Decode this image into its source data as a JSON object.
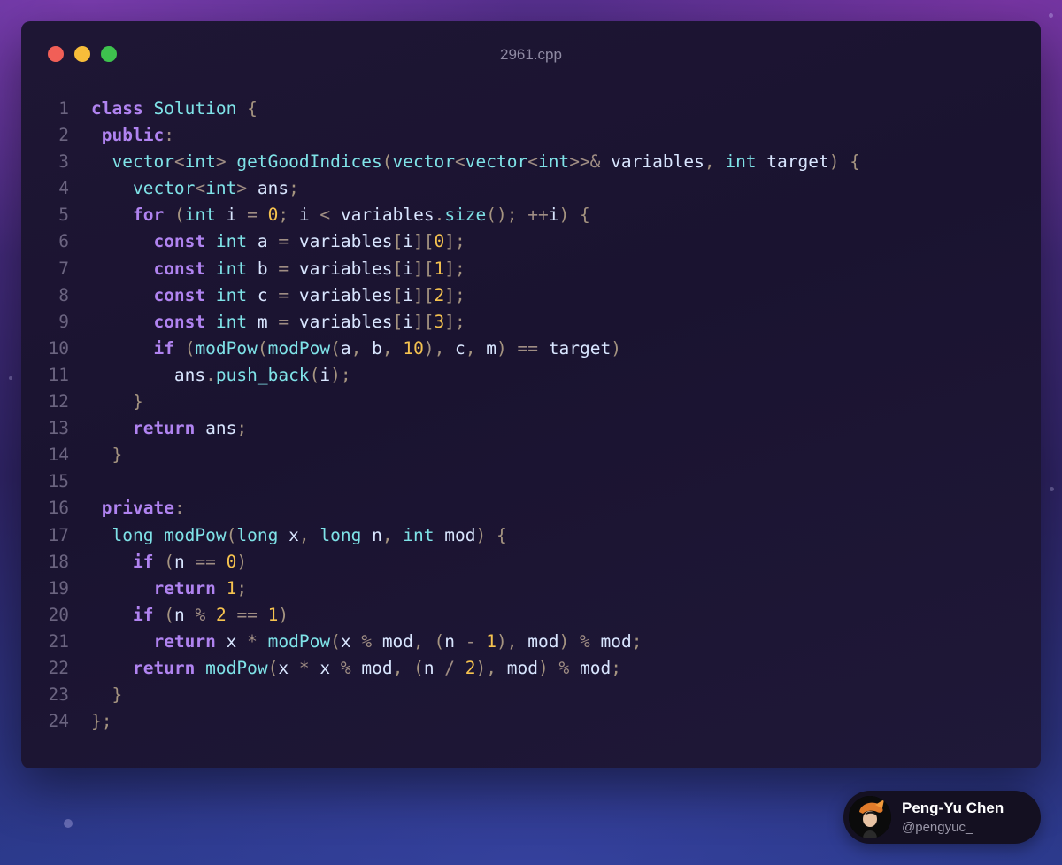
{
  "window": {
    "filename": "2961.cpp"
  },
  "code_lines": [
    [
      [
        "kw",
        "class"
      ],
      [
        "id",
        " "
      ],
      [
        "ty",
        "Solution"
      ],
      [
        "id",
        " "
      ],
      [
        "pn",
        "{"
      ]
    ],
    [
      [
        "id",
        " "
      ],
      [
        "kw",
        "public"
      ],
      [
        "op",
        ":"
      ]
    ],
    [
      [
        "id",
        "  "
      ],
      [
        "ty",
        "vector"
      ],
      [
        "op",
        "<"
      ],
      [
        "ty",
        "int"
      ],
      [
        "op",
        ">"
      ],
      [
        "id",
        " "
      ],
      [
        "fn",
        "getGoodIndices"
      ],
      [
        "pn",
        "("
      ],
      [
        "ty",
        "vector"
      ],
      [
        "op",
        "<"
      ],
      [
        "ty",
        "vector"
      ],
      [
        "op",
        "<"
      ],
      [
        "ty",
        "int"
      ],
      [
        "op",
        ">>&"
      ],
      [
        "id",
        " variables"
      ],
      [
        "pn",
        ","
      ],
      [
        "id",
        " "
      ],
      [
        "ty",
        "int"
      ],
      [
        "id",
        " target"
      ],
      [
        "pn",
        ")"
      ],
      [
        "id",
        " "
      ],
      [
        "pn",
        "{"
      ]
    ],
    [
      [
        "id",
        "    "
      ],
      [
        "ty",
        "vector"
      ],
      [
        "op",
        "<"
      ],
      [
        "ty",
        "int"
      ],
      [
        "op",
        ">"
      ],
      [
        "id",
        " ans"
      ],
      [
        "pn",
        ";"
      ]
    ],
    [
      [
        "id",
        "    "
      ],
      [
        "kw",
        "for"
      ],
      [
        "id",
        " "
      ],
      [
        "pn",
        "("
      ],
      [
        "ty",
        "int"
      ],
      [
        "id",
        " i "
      ],
      [
        "op",
        "="
      ],
      [
        "id",
        " "
      ],
      [
        "num",
        "0"
      ],
      [
        "pn",
        ";"
      ],
      [
        "id",
        " i "
      ],
      [
        "op",
        "<"
      ],
      [
        "id",
        " variables"
      ],
      [
        "op",
        "."
      ],
      [
        "fn",
        "size"
      ],
      [
        "pn",
        "()"
      ],
      [
        "pn",
        ";"
      ],
      [
        "id",
        " "
      ],
      [
        "op",
        "++"
      ],
      [
        "id",
        "i"
      ],
      [
        "pn",
        ")"
      ],
      [
        "id",
        " "
      ],
      [
        "pn",
        "{"
      ]
    ],
    [
      [
        "id",
        "      "
      ],
      [
        "kw",
        "const"
      ],
      [
        "id",
        " "
      ],
      [
        "ty",
        "int"
      ],
      [
        "id",
        " a "
      ],
      [
        "op",
        "="
      ],
      [
        "id",
        " variables"
      ],
      [
        "pn",
        "["
      ],
      [
        "id",
        "i"
      ],
      [
        "pn",
        "]["
      ],
      [
        "num",
        "0"
      ],
      [
        "pn",
        "]"
      ],
      [
        "pn",
        ";"
      ]
    ],
    [
      [
        "id",
        "      "
      ],
      [
        "kw",
        "const"
      ],
      [
        "id",
        " "
      ],
      [
        "ty",
        "int"
      ],
      [
        "id",
        " b "
      ],
      [
        "op",
        "="
      ],
      [
        "id",
        " variables"
      ],
      [
        "pn",
        "["
      ],
      [
        "id",
        "i"
      ],
      [
        "pn",
        "]["
      ],
      [
        "num",
        "1"
      ],
      [
        "pn",
        "]"
      ],
      [
        "pn",
        ";"
      ]
    ],
    [
      [
        "id",
        "      "
      ],
      [
        "kw",
        "const"
      ],
      [
        "id",
        " "
      ],
      [
        "ty",
        "int"
      ],
      [
        "id",
        " c "
      ],
      [
        "op",
        "="
      ],
      [
        "id",
        " variables"
      ],
      [
        "pn",
        "["
      ],
      [
        "id",
        "i"
      ],
      [
        "pn",
        "]["
      ],
      [
        "num",
        "2"
      ],
      [
        "pn",
        "]"
      ],
      [
        "pn",
        ";"
      ]
    ],
    [
      [
        "id",
        "      "
      ],
      [
        "kw",
        "const"
      ],
      [
        "id",
        " "
      ],
      [
        "ty",
        "int"
      ],
      [
        "id",
        " m "
      ],
      [
        "op",
        "="
      ],
      [
        "id",
        " variables"
      ],
      [
        "pn",
        "["
      ],
      [
        "id",
        "i"
      ],
      [
        "pn",
        "]["
      ],
      [
        "num",
        "3"
      ],
      [
        "pn",
        "]"
      ],
      [
        "pn",
        ";"
      ]
    ],
    [
      [
        "id",
        "      "
      ],
      [
        "kw",
        "if"
      ],
      [
        "id",
        " "
      ],
      [
        "pn",
        "("
      ],
      [
        "fn",
        "modPow"
      ],
      [
        "pn",
        "("
      ],
      [
        "fn",
        "modPow"
      ],
      [
        "pn",
        "("
      ],
      [
        "id",
        "a"
      ],
      [
        "pn",
        ","
      ],
      [
        "id",
        " b"
      ],
      [
        "pn",
        ","
      ],
      [
        "id",
        " "
      ],
      [
        "num",
        "10"
      ],
      [
        "pn",
        ")"
      ],
      [
        "pn",
        ","
      ],
      [
        "id",
        " c"
      ],
      [
        "pn",
        ","
      ],
      [
        "id",
        " m"
      ],
      [
        "pn",
        ")"
      ],
      [
        "id",
        " "
      ],
      [
        "op",
        "=="
      ],
      [
        "id",
        " target"
      ],
      [
        "pn",
        ")"
      ]
    ],
    [
      [
        "id",
        "        ans"
      ],
      [
        "op",
        "."
      ],
      [
        "fn",
        "push_back"
      ],
      [
        "pn",
        "("
      ],
      [
        "id",
        "i"
      ],
      [
        "pn",
        ")"
      ],
      [
        "pn",
        ";"
      ]
    ],
    [
      [
        "id",
        "    "
      ],
      [
        "pn",
        "}"
      ]
    ],
    [
      [
        "id",
        "    "
      ],
      [
        "kw",
        "return"
      ],
      [
        "id",
        " ans"
      ],
      [
        "pn",
        ";"
      ]
    ],
    [
      [
        "id",
        "  "
      ],
      [
        "pn",
        "}"
      ]
    ],
    [],
    [
      [
        "id",
        " "
      ],
      [
        "kw",
        "private"
      ],
      [
        "op",
        ":"
      ]
    ],
    [
      [
        "id",
        "  "
      ],
      [
        "ty",
        "long"
      ],
      [
        "id",
        " "
      ],
      [
        "fn",
        "modPow"
      ],
      [
        "pn",
        "("
      ],
      [
        "ty",
        "long"
      ],
      [
        "id",
        " x"
      ],
      [
        "pn",
        ","
      ],
      [
        "id",
        " "
      ],
      [
        "ty",
        "long"
      ],
      [
        "id",
        " n"
      ],
      [
        "pn",
        ","
      ],
      [
        "id",
        " "
      ],
      [
        "ty",
        "int"
      ],
      [
        "id",
        " mod"
      ],
      [
        "pn",
        ")"
      ],
      [
        "id",
        " "
      ],
      [
        "pn",
        "{"
      ]
    ],
    [
      [
        "id",
        "    "
      ],
      [
        "kw",
        "if"
      ],
      [
        "id",
        " "
      ],
      [
        "pn",
        "("
      ],
      [
        "id",
        "n "
      ],
      [
        "op",
        "=="
      ],
      [
        "id",
        " "
      ],
      [
        "num",
        "0"
      ],
      [
        "pn",
        ")"
      ]
    ],
    [
      [
        "id",
        "      "
      ],
      [
        "kw",
        "return"
      ],
      [
        "id",
        " "
      ],
      [
        "num",
        "1"
      ],
      [
        "pn",
        ";"
      ]
    ],
    [
      [
        "id",
        "    "
      ],
      [
        "kw",
        "if"
      ],
      [
        "id",
        " "
      ],
      [
        "pn",
        "("
      ],
      [
        "id",
        "n "
      ],
      [
        "op",
        "%"
      ],
      [
        "id",
        " "
      ],
      [
        "num",
        "2"
      ],
      [
        "id",
        " "
      ],
      [
        "op",
        "=="
      ],
      [
        "id",
        " "
      ],
      [
        "num",
        "1"
      ],
      [
        "pn",
        ")"
      ]
    ],
    [
      [
        "id",
        "      "
      ],
      [
        "kw",
        "return"
      ],
      [
        "id",
        " x "
      ],
      [
        "op",
        "*"
      ],
      [
        "id",
        " "
      ],
      [
        "fn",
        "modPow"
      ],
      [
        "pn",
        "("
      ],
      [
        "id",
        "x "
      ],
      [
        "op",
        "%"
      ],
      [
        "id",
        " mod"
      ],
      [
        "pn",
        ","
      ],
      [
        "id",
        " "
      ],
      [
        "pn",
        "("
      ],
      [
        "id",
        "n "
      ],
      [
        "op",
        "-"
      ],
      [
        "id",
        " "
      ],
      [
        "num",
        "1"
      ],
      [
        "pn",
        ")"
      ],
      [
        "pn",
        ","
      ],
      [
        "id",
        " mod"
      ],
      [
        "pn",
        ")"
      ],
      [
        "id",
        " "
      ],
      [
        "op",
        "%"
      ],
      [
        "id",
        " mod"
      ],
      [
        "pn",
        ";"
      ]
    ],
    [
      [
        "id",
        "    "
      ],
      [
        "kw",
        "return"
      ],
      [
        "id",
        " "
      ],
      [
        "fn",
        "modPow"
      ],
      [
        "pn",
        "("
      ],
      [
        "id",
        "x "
      ],
      [
        "op",
        "*"
      ],
      [
        "id",
        " x "
      ],
      [
        "op",
        "%"
      ],
      [
        "id",
        " mod"
      ],
      [
        "pn",
        ","
      ],
      [
        "id",
        " "
      ],
      [
        "pn",
        "("
      ],
      [
        "id",
        "n "
      ],
      [
        "op",
        "/"
      ],
      [
        "id",
        " "
      ],
      [
        "num",
        "2"
      ],
      [
        "pn",
        ")"
      ],
      [
        "pn",
        ","
      ],
      [
        "id",
        " mod"
      ],
      [
        "pn",
        ")"
      ],
      [
        "id",
        " "
      ],
      [
        "op",
        "%"
      ],
      [
        "id",
        " mod"
      ],
      [
        "pn",
        ";"
      ]
    ],
    [
      [
        "id",
        "  "
      ],
      [
        "pn",
        "}"
      ]
    ],
    [
      [
        "pn",
        "};"
      ]
    ]
  ],
  "profile": {
    "name": "Peng-Yu Chen",
    "handle": "@pengyuc_"
  },
  "colors": {
    "keyword": "#b083f0",
    "type": "#7fe3e8",
    "identifier": "#d9e6ff",
    "number": "#f6c34f",
    "operator": "#a08e84",
    "line_number": "#6b6480"
  }
}
